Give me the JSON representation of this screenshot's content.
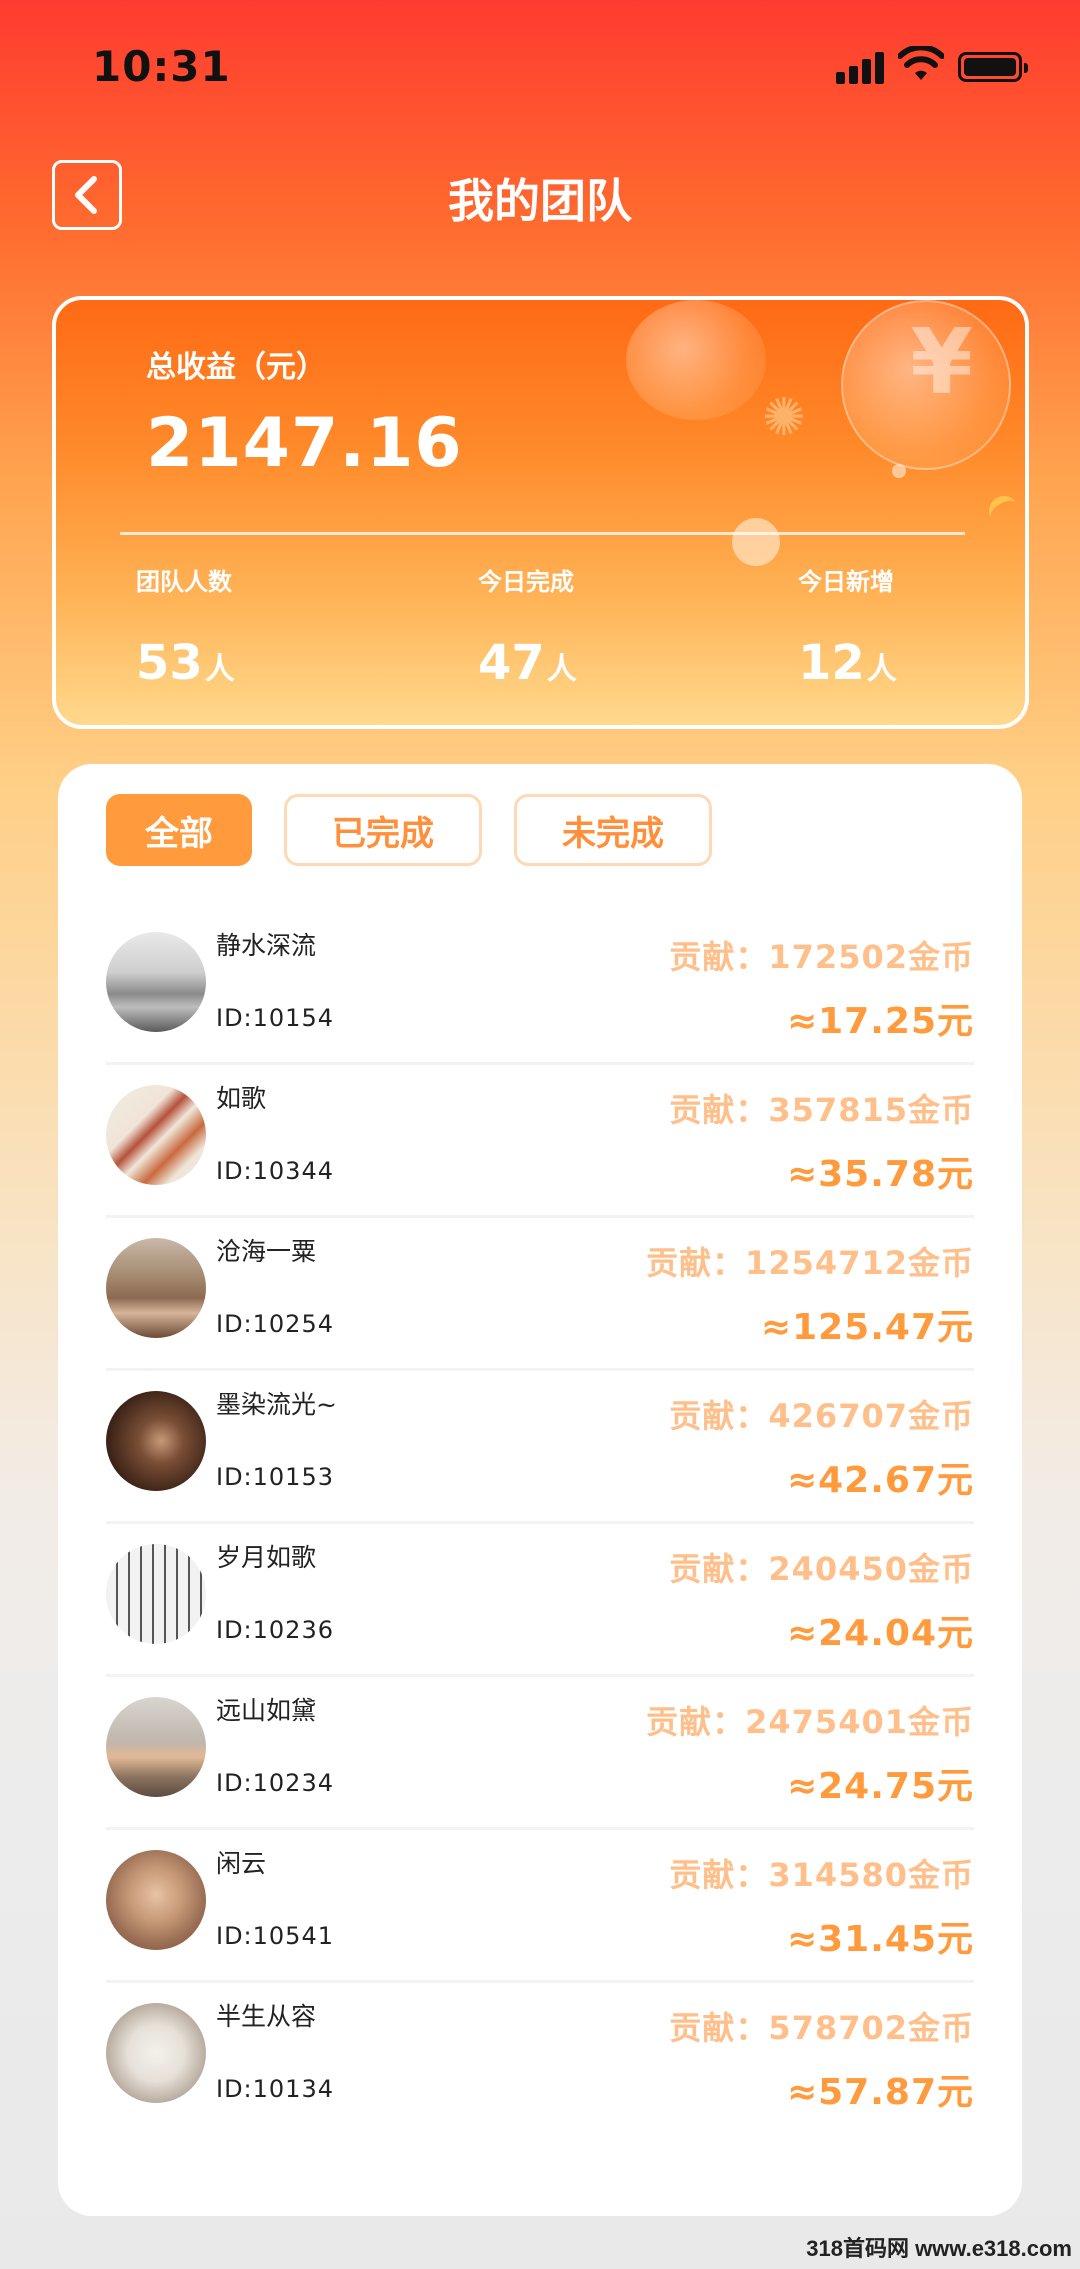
{
  "status_bar": {
    "time": "10:31"
  },
  "header": {
    "title": "我的团队"
  },
  "summary": {
    "total_label": "总收益（元）",
    "total_value": "2147.16",
    "stats": [
      {
        "label": "团队人数",
        "value": "53",
        "unit": "人"
      },
      {
        "label": "今日完成",
        "value": "47",
        "unit": "人"
      },
      {
        "label": "今日新增",
        "value": "12",
        "unit": "人"
      }
    ]
  },
  "tabs": [
    {
      "label": "全部",
      "active": true
    },
    {
      "label": "已完成",
      "active": false
    },
    {
      "label": "未完成",
      "active": false
    }
  ],
  "members": [
    {
      "name": "静水深流",
      "id": "ID:10154",
      "contribution": "贡献：172502金币",
      "amount": "≈17.25元"
    },
    {
      "name": "如歌",
      "id": "ID:10344",
      "contribution": "贡献：357815金币",
      "amount": "≈35.78元"
    },
    {
      "name": "沧海一粟",
      "id": "ID:10254",
      "contribution": "贡献：1254712金币",
      "amount": "≈125.47元"
    },
    {
      "name": "墨染流光~",
      "id": "ID:10153",
      "contribution": "贡献：426707金币",
      "amount": "≈42.67元"
    },
    {
      "name": "岁月如歌",
      "id": "ID:10236",
      "contribution": "贡献：240450金币",
      "amount": "≈24.04元"
    },
    {
      "name": "远山如黛",
      "id": "ID:10234",
      "contribution": "贡献：2475401金币",
      "amount": "≈24.75元"
    },
    {
      "name": "闲云",
      "id": "ID:10541",
      "contribution": "贡献：314580金币",
      "amount": "≈31.45元"
    },
    {
      "name": "半生从容",
      "id": "ID:10134",
      "contribution": "贡献：578702金币",
      "amount": "≈57.87元"
    }
  ],
  "watermark": "318首码网 www.e318.com",
  "colors": {
    "accent": "#ff9a3d",
    "contribution": "#ffbf8a",
    "header_start": "#ff3b30"
  }
}
